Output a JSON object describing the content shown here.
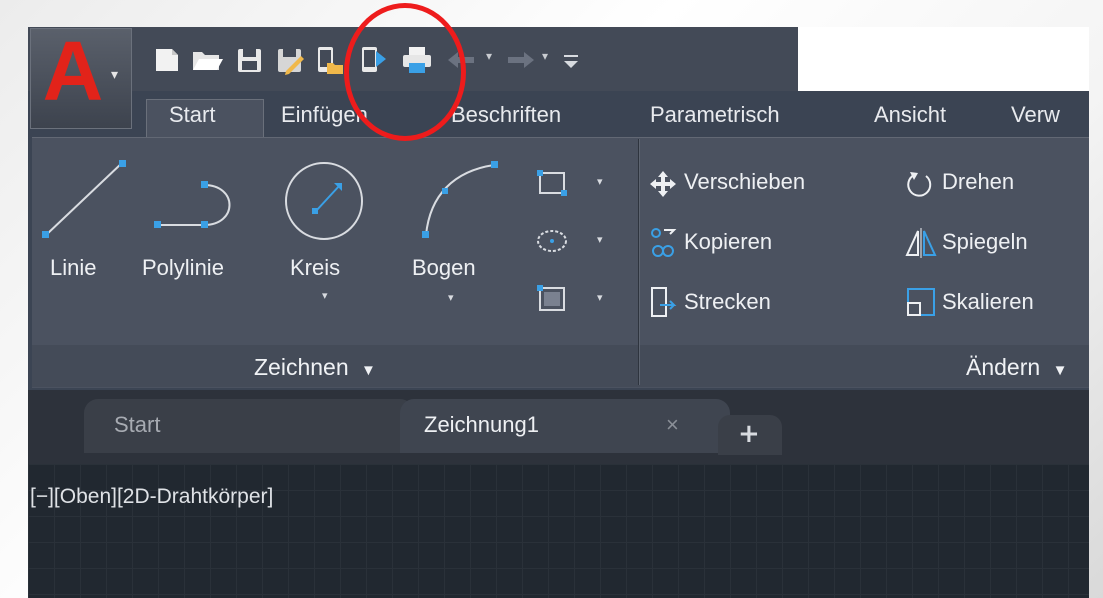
{
  "app": {
    "name": "AutoCAD",
    "logo_letter": "A",
    "accent_color": "#e2231a"
  },
  "quick_access_toolbar": {
    "icons": [
      "new-icon",
      "open-icon",
      "save-icon",
      "save-as-icon",
      "open-from-web-icon",
      "save-to-web-icon",
      "plot-icon",
      "undo-icon",
      "redo-icon",
      "customize-icon"
    ],
    "highlighted_icon": "open-from-web-icon",
    "highlight_color": "#ee1c1c"
  },
  "ribbon": {
    "tabs": [
      {
        "label": "Start",
        "active": true
      },
      {
        "label": "Einfügen"
      },
      {
        "label": "Beschriften"
      },
      {
        "label": "Parametrisch"
      },
      {
        "label": "Ansicht"
      },
      {
        "label": "Verw"
      }
    ],
    "draw_panel": {
      "title": "Zeichnen",
      "tools": [
        {
          "label": "Linie",
          "icon": "line-icon"
        },
        {
          "label": "Polylinie",
          "icon": "polyline-icon"
        },
        {
          "label": "Kreis",
          "icon": "circle-icon"
        },
        {
          "label": "Bogen",
          "icon": "arc-icon"
        }
      ],
      "small_tools": [
        "rectangle-icon",
        "ellipse-icon",
        "hatch-icon"
      ]
    },
    "modify_panel": {
      "title": "Ändern",
      "tools": [
        {
          "label": "Verschieben",
          "icon": "move-icon"
        },
        {
          "label": "Drehen",
          "icon": "rotate-icon"
        },
        {
          "label": "Kopieren",
          "icon": "copy-icon"
        },
        {
          "label": "Spiegeln",
          "icon": "mirror-icon"
        },
        {
          "label": "Strecken",
          "icon": "stretch-icon"
        },
        {
          "label": "Skalieren",
          "icon": "scale-icon"
        }
      ]
    }
  },
  "file_tabs": [
    {
      "label": "Start"
    },
    {
      "label": "Zeichnung1",
      "active": true,
      "close": "×"
    }
  ],
  "new_tab_label": "+",
  "viewport": {
    "label": "[−][Oben][2D-Drahtkörper]"
  }
}
